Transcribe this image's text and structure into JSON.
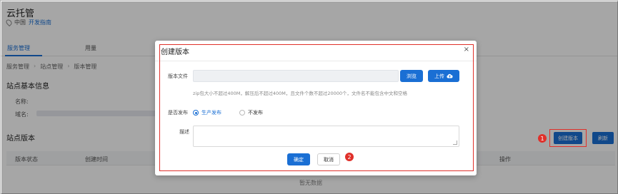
{
  "page": {
    "title": "云托管",
    "region": "中国",
    "dev_guide": "开发指南",
    "tabs": [
      "服务管理",
      "用量"
    ],
    "breadcrumb": [
      "服务管理",
      "站点管理",
      "版本管理"
    ],
    "site_info_title": "站点基本信息",
    "name_label": "名称:",
    "domain_label": "域名:",
    "versions_title": "站点版本",
    "create_version_button": "创建版本",
    "refresh_button": "刷新",
    "table_headers": [
      "版本状态",
      "创建时间",
      "操作"
    ],
    "empty_text": "暂无数据"
  },
  "modal": {
    "title": "创建版本",
    "close": "×",
    "version_file_label": "版本文件",
    "browse_button": "浏览",
    "upload_button": "上传",
    "hint": "zip包大小不超过400M，解压后不超过400M，且文件个数不超过20000个，文件名不能包含中文和空格",
    "publish_label": "是否发布",
    "radio_publish": "生产发布",
    "radio_no_publish": "不发布",
    "description_label": "描述",
    "ok_button": "确定",
    "cancel_button": "取消"
  },
  "annotations": {
    "step1": "1",
    "step2": "2",
    "highlight_color": "#e0302a"
  },
  "colors": {
    "primary": "#1a6fd4"
  }
}
